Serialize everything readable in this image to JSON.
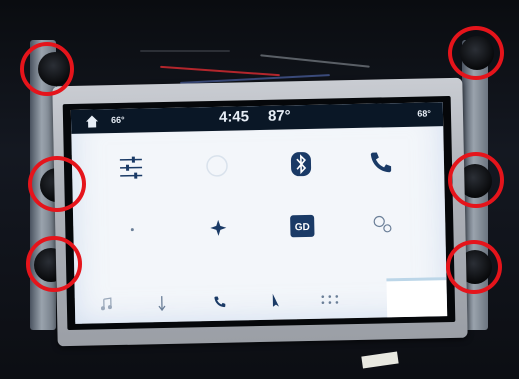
{
  "statusbar": {
    "outside_temp_left": "66°",
    "time": "4:45",
    "center_temp": "87°",
    "outside_temp_right": "68°"
  },
  "app_grid": {
    "icons": [
      "settings-sliders-icon",
      "climate-icon",
      "bluetooth-icon",
      "phone-icon",
      "dot-icon",
      "sparkle-icon",
      "gd-app-icon",
      "bubbles-icon"
    ],
    "gd_label": "GD"
  },
  "nav_bar": {
    "icons": [
      "music-note-icon",
      "climate-down-icon",
      "phone-icon",
      "navigation-icon",
      "apps-grid-icon"
    ]
  },
  "colors": {
    "annotation_red": "#e5141b",
    "statusbar_bg": "#0a1726",
    "screen_bg": "#f3f6fa",
    "icon_blue": "#1a3a66"
  }
}
